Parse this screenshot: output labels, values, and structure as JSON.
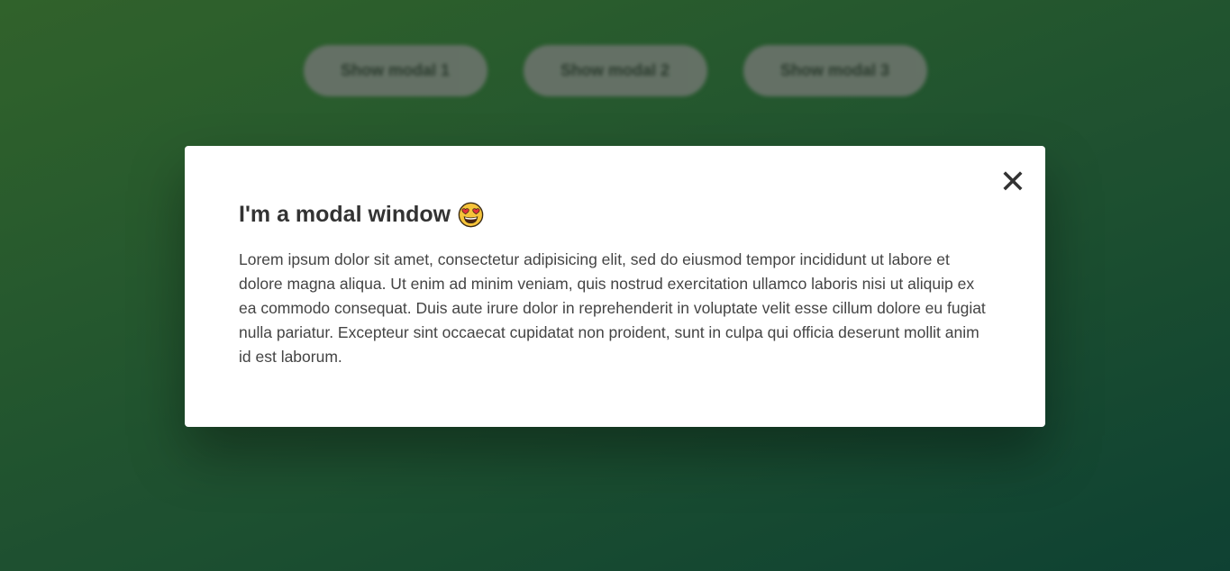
{
  "background": {
    "buttons": [
      {
        "label": "Show modal 1"
      },
      {
        "label": "Show modal 2"
      },
      {
        "label": "Show modal 3"
      }
    ],
    "gradient_colors": [
      "#34692e",
      "#104637"
    ]
  },
  "modal": {
    "title": "I'm a modal window",
    "emoji_icon": "smiling-face-with-heart-eyes",
    "close_glyph": "✕",
    "body": "Lorem ipsum dolor sit amet, consectetur adipisicing elit, sed do eiusmod tempor incididunt ut labore et dolore magna aliqua. Ut enim ad minim veniam, quis nostrud exercitation ullamco laboris nisi ut aliquip ex ea commodo consequat. Duis aute irure dolor in reprehenderit in voluptate velit esse cillum dolore eu fugiat nulla pariatur. Excepteur sint occaecat cupidatat non proident, sunt in culpa qui officia deserunt mollit anim id est laborum."
  }
}
